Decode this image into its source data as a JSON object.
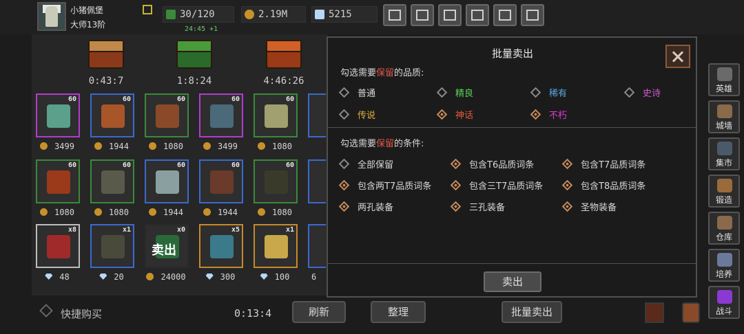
{
  "player": {
    "name": "小猪佩堡",
    "rank": "大师13阶"
  },
  "resources": {
    "energy": "30/120",
    "energy_timer": "24:45 +1",
    "gold": "2.19M",
    "gems": "5215"
  },
  "top_buttons": [
    "cart-icon",
    "mail-icon",
    "gamepad-icon",
    "gear-icon",
    "color-wheel-icon",
    "feather-icon"
  ],
  "chests": [
    {
      "timer": "0:43:7",
      "color": "#8a3a1a",
      "lid": "#c0884a"
    },
    {
      "timer": "1:8:24",
      "color": "#2a6a2a",
      "lid": "#4a9a3a"
    },
    {
      "timer": "4:46:26",
      "color": "#9a3a16",
      "lid": "#d06028"
    }
  ],
  "shop_rows": [
    [
      {
        "level": "60",
        "price": "3499",
        "border": "#b43ad0",
        "item": "#5aa08a"
      },
      {
        "level": "60",
        "price": "1944",
        "border": "#3a6ad0",
        "item": "#a8552a"
      },
      {
        "level": "60",
        "price": "1080",
        "border": "#3a8a3a",
        "item": "#8a4a2a"
      },
      {
        "level": "60",
        "price": "3499",
        "border": "#b43ad0",
        "item": "#4a6a7a"
      },
      {
        "level": "60",
        "price": "1080",
        "border": "#3a8a3a",
        "item": "#a0a070"
      }
    ],
    [
      {
        "level": "60",
        "price": "1080",
        "border": "#3a8a3a",
        "item": "#9a3a1a"
      },
      {
        "level": "60",
        "price": "1080",
        "border": "#3a8a3a",
        "item": "#5a5a4a"
      },
      {
        "level": "60",
        "price": "1944",
        "border": "#3a6ad0",
        "item": "#8aa0a0"
      },
      {
        "level": "60",
        "price": "1944",
        "border": "#3a6ad0",
        "item": "#6a3a2a"
      },
      {
        "level": "60",
        "price": "1080",
        "border": "#3a8a3a",
        "item": "#3a3a2a"
      }
    ],
    [
      {
        "level": "x8",
        "price": "48",
        "border": "#bdbdbd",
        "item": "#a02a2a",
        "currency": "gem"
      },
      {
        "level": "x1",
        "price": "20",
        "border": "#3a6ad0",
        "item": "#4a4a3a",
        "currency": "gem"
      },
      {
        "level": "x0",
        "price": "24000",
        "border": "#2a2a2a",
        "item": "#2a6a3a",
        "currency": "coin",
        "sold": "卖出"
      },
      {
        "level": "x5",
        "price": "300",
        "border": "#c88a2a",
        "item": "#3a7a8a",
        "currency": "gem"
      },
      {
        "level": "x1",
        "price": "100",
        "border": "#c88a2a",
        "item": "#c8a84a",
        "currency": "gem"
      }
    ]
  ],
  "partial_prices": {
    "row3": "6"
  },
  "bottom": {
    "quick_buy": "快捷购买",
    "refresh_timer": "0:13:4",
    "refresh": "刷新",
    "organize": "整理",
    "batch_sell": "批量卖出"
  },
  "dialog": {
    "title": "批量卖出",
    "quality_label_pre": "勾选需要",
    "quality_label_hl": "保留",
    "quality_label_post": "的品质:",
    "qualities": [
      {
        "label": "普通",
        "color": "#d8d8d8",
        "checked": false
      },
      {
        "label": "精良",
        "color": "#5ad05a",
        "checked": false
      },
      {
        "label": "稀有",
        "color": "#5aa8e0",
        "checked": false
      },
      {
        "label": "史诗",
        "color": "#d05ad0",
        "checked": false
      },
      {
        "label": "传说",
        "color": "#e0b040",
        "checked": false
      },
      {
        "label": "神话",
        "color": "#e05a3a",
        "checked": true
      },
      {
        "label": "不朽",
        "color": "#e03ad0",
        "checked": true
      }
    ],
    "condition_label_pre": "勾选需要",
    "condition_label_hl": "保留",
    "condition_label_post": "的条件:",
    "conditions": [
      {
        "label": "全部保留",
        "checked": false
      },
      {
        "label": "包含T6品质词条",
        "checked": true
      },
      {
        "label": "包含T7品质词条",
        "checked": true
      },
      {
        "label": "包含两T7品质词条",
        "checked": true
      },
      {
        "label": "包含三T7品质词条",
        "checked": true
      },
      {
        "label": "包含T8品质词条",
        "checked": true
      },
      {
        "label": "两孔装备",
        "checked": true
      },
      {
        "label": "三孔装备",
        "checked": true
      },
      {
        "label": "圣物装备",
        "checked": true
      }
    ],
    "sell_button": "卖出"
  },
  "sidebar": [
    {
      "label": "英雄",
      "icon": "helmet-icon",
      "color": "#6a6a6a"
    },
    {
      "label": "城墙",
      "icon": "wall-icon",
      "color": "#8a6a4a"
    },
    {
      "label": "集市",
      "icon": "market-icon",
      "color": "#4a5a6a"
    },
    {
      "label": "锻造",
      "icon": "anvil-icon",
      "color": "#9a6a3a"
    },
    {
      "label": "仓库",
      "icon": "warehouse-icon",
      "color": "#8a6a4a"
    },
    {
      "label": "培养",
      "icon": "trophy-icon",
      "color": "#6a7a9a"
    },
    {
      "label": "战斗",
      "icon": "vortex-icon",
      "color": "#8a3ad0"
    }
  ]
}
